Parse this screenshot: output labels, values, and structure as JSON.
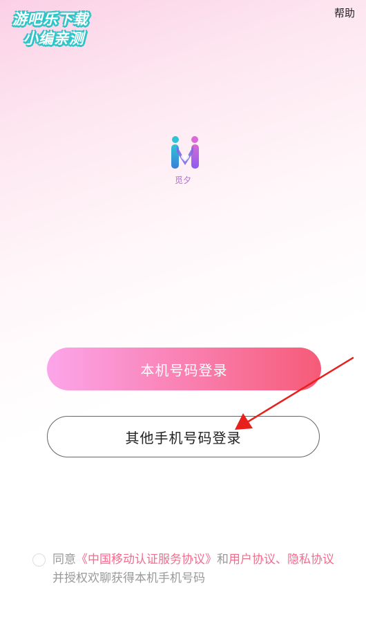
{
  "watermark": {
    "line1": "游吧乐下载",
    "line2": "小编亲测"
  },
  "header": {
    "help_label": "帮助"
  },
  "app": {
    "name": "觅夕",
    "logo_icon": "m-logo-icon"
  },
  "login": {
    "primary_label": "本机号码登录",
    "secondary_label": "其他手机号码登录"
  },
  "agreement": {
    "prefix": "同意",
    "cmcc_link": "《中国移动认证服务协议》",
    "and": "和",
    "user_link": "用户协议",
    "separator": "、",
    "privacy_link": "隐私协议",
    "suffix": "并授权欢聊获得本机手机号码"
  },
  "colors": {
    "accent_pink": "#f56b8c",
    "button_gradient_start": "#fca5ea",
    "button_gradient_end": "#f65b78",
    "annotation_arrow": "#e8201c"
  }
}
